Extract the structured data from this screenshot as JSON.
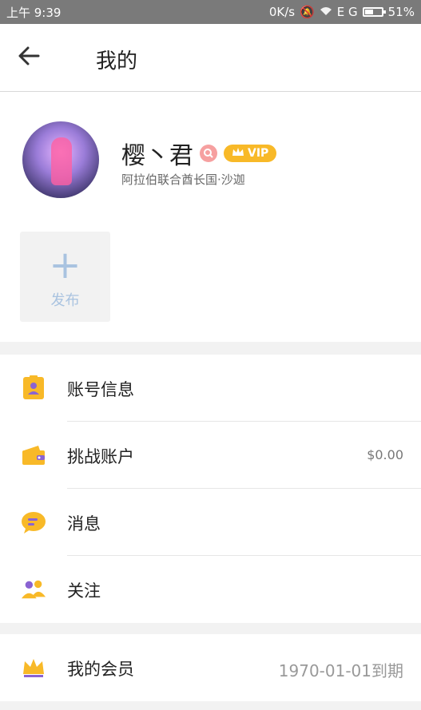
{
  "status_bar": {
    "time": "上午 9:39",
    "network": "0K/s",
    "signal": "E G",
    "battery": "51%",
    "battery_level": 0.51
  },
  "header": {
    "back_icon": "arrow-left-icon",
    "title": "我的"
  },
  "profile": {
    "name": "樱丶君",
    "vip_label": "VIP",
    "location": "阿拉伯联合酋长国·沙迦"
  },
  "publish": {
    "label": "发布"
  },
  "menu": [
    {
      "label": "账号信息",
      "icon": "id-card-icon"
    },
    {
      "label": "挑战账户",
      "icon": "wallet-icon",
      "value": "$0.00"
    },
    {
      "label": "消息",
      "icon": "chat-bubble-icon"
    },
    {
      "label": "关注",
      "icon": "people-icon"
    }
  ],
  "membership": {
    "label": "我的会员",
    "icon": "crown-icon",
    "value": "1970-01-01到期"
  },
  "colors": {
    "accent_yellow": "#f8b928",
    "accent_purple": "#8a63d2",
    "publish_blue": "#a9c3e0"
  }
}
